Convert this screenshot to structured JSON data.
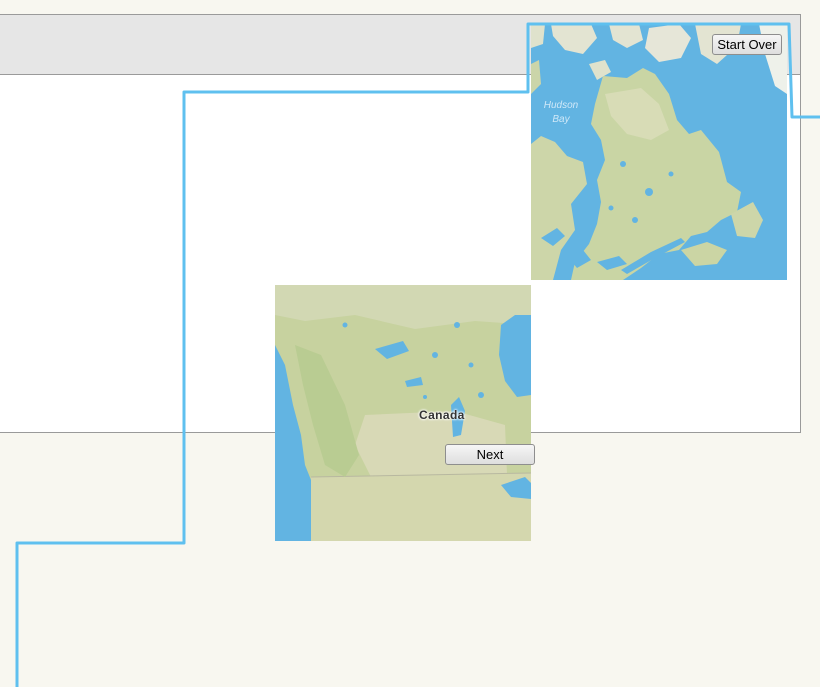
{
  "controls": {
    "start_over_label": "Start Over",
    "next_label": "Next"
  },
  "map": {
    "country_label": "Canada",
    "water_label_line1": "Hudson",
    "water_label_line2": "Bay"
  },
  "colors": {
    "page_background": "#f8f7f0",
    "route_line": "#5fc0ef",
    "water": "#62b4e2",
    "land_light": "#d4dbb2",
    "land_forest": "#bccf98"
  }
}
